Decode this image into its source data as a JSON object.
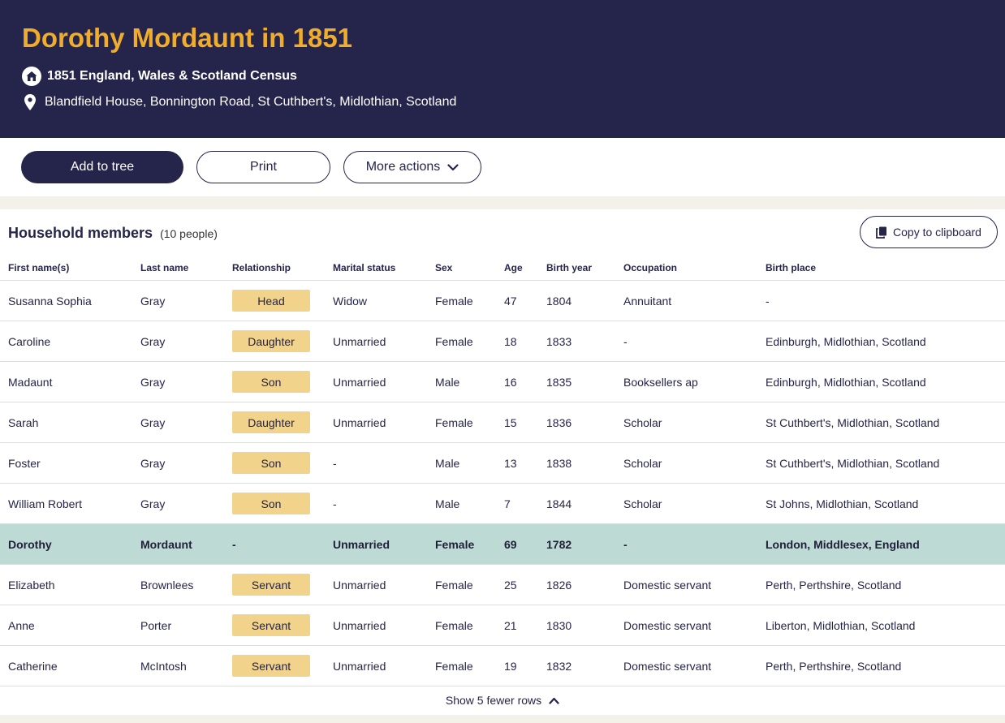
{
  "header": {
    "title": "Dorothy Mordaunt in 1851",
    "census": "1851 England, Wales & Scotland Census",
    "address": "Blandfield House, Bonnington Road, St Cuthbert's, Midlothian, Scotland",
    "colors": {
      "background": "#25244a",
      "title": "#f0ad2c"
    }
  },
  "actions": {
    "add_to_tree": "Add to tree",
    "print": "Print",
    "more_actions": "More actions"
  },
  "household": {
    "title": "Household members",
    "count": "(10 people)",
    "copy_label": "Copy to clipboard",
    "columns": [
      "First name(s)",
      "Last name",
      "Relationship",
      "Marital status",
      "Sex",
      "Age",
      "Birth year",
      "Occupation",
      "Birth place"
    ],
    "rows": [
      {
        "first": "Susanna Sophia",
        "last": "Gray",
        "relationship": "Head",
        "marital": "Widow",
        "sex": "Female",
        "age": "47",
        "birth_year": "1804",
        "occupation": "Annuitant",
        "birth_place": "-"
      },
      {
        "first": "Caroline",
        "last": "Gray",
        "relationship": "Daughter",
        "marital": "Unmarried",
        "sex": "Female",
        "age": "18",
        "birth_year": "1833",
        "occupation": "-",
        "birth_place": "Edinburgh, Midlothian, Scotland"
      },
      {
        "first": "Madaunt",
        "last": "Gray",
        "relationship": "Son",
        "marital": "Unmarried",
        "sex": "Male",
        "age": "16",
        "birth_year": "1835",
        "occupation": "Booksellers ap",
        "birth_place": "Edinburgh, Midlothian, Scotland"
      },
      {
        "first": "Sarah",
        "last": "Gray",
        "relationship": "Daughter",
        "marital": "Unmarried",
        "sex": "Female",
        "age": "15",
        "birth_year": "1836",
        "occupation": "Scholar",
        "birth_place": "St Cuthbert's, Midlothian, Scotland"
      },
      {
        "first": "Foster",
        "last": "Gray",
        "relationship": "Son",
        "marital": "-",
        "sex": "Male",
        "age": "13",
        "birth_year": "1838",
        "occupation": "Scholar",
        "birth_place": "St Cuthbert's, Midlothian, Scotland"
      },
      {
        "first": "William Robert",
        "last": "Gray",
        "relationship": "Son",
        "marital": "-",
        "sex": "Male",
        "age": "7",
        "birth_year": "1844",
        "occupation": "Scholar",
        "birth_place": "St Johns, Midlothian, Scotland"
      },
      {
        "first": "Dorothy",
        "last": "Mordaunt",
        "relationship": "-",
        "marital": "Unmarried",
        "sex": "Female",
        "age": "69",
        "birth_year": "1782",
        "occupation": "-",
        "birth_place": "London, Middlesex, England",
        "highlighted": true
      },
      {
        "first": "Elizabeth",
        "last": "Brownlees",
        "relationship": "Servant",
        "marital": "Unmarried",
        "sex": "Female",
        "age": "25",
        "birth_year": "1826",
        "occupation": "Domestic servant",
        "birth_place": "Perth, Perthshire, Scotland"
      },
      {
        "first": "Anne",
        "last": "Porter",
        "relationship": "Servant",
        "marital": "Unmarried",
        "sex": "Female",
        "age": "21",
        "birth_year": "1830",
        "occupation": "Domestic servant",
        "birth_place": "Liberton, Midlothian, Scotland"
      },
      {
        "first": "Catherine",
        "last": "McIntosh",
        "relationship": "Servant",
        "marital": "Unmarried",
        "sex": "Female",
        "age": "19",
        "birth_year": "1832",
        "occupation": "Domestic servant",
        "birth_place": "Perth, Perthshire, Scotland"
      }
    ],
    "toggle_label": "Show 5 fewer rows",
    "colors": {
      "highlight_row": "#bedad4",
      "relationship_badge": "#f1d38c"
    }
  }
}
